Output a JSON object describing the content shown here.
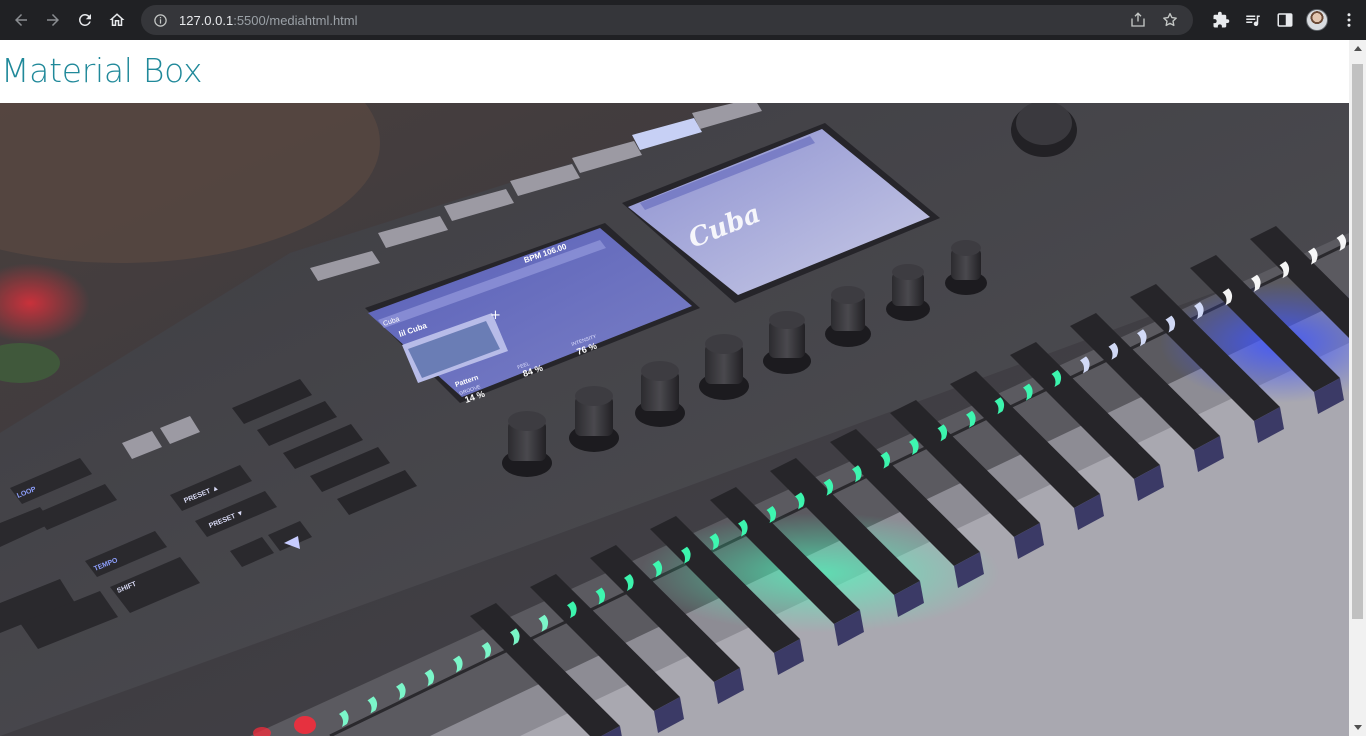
{
  "browser": {
    "url_host": "127.0.0.1",
    "url_rest": ":5500/mediahtml.html",
    "icons": [
      "back-icon",
      "forward-icon",
      "reload-icon",
      "home-icon",
      "site-info-icon",
      "share-icon",
      "bookmark-star-icon",
      "extensions-icon",
      "media-queue-icon",
      "side-panel-icon",
      "profile-avatar",
      "menu-dots-icon"
    ]
  },
  "page": {
    "title": "Material Box",
    "title_color": "#20899a",
    "image": {
      "subject": "MIDI keyboard controller with illuminated keys",
      "screen_left": {
        "header": "BPM 106.00",
        "label": "Cuba",
        "preset": "lil Cuba",
        "pattern": "Pattern",
        "groove": "GROOVE",
        "groove_value": "14 %",
        "feel": "FEEL",
        "feel_value": "84 %",
        "intensity": "INTENSITY",
        "intensity_value": "76 %"
      },
      "screen_right": {
        "logo": "Cuba"
      },
      "buttons": {
        "preset_up": "PRESET ▲",
        "preset_down": "PRESET ▼",
        "tempo": "TEMPO",
        "shift": "SHIFT",
        "loop": "LOOP"
      }
    }
  }
}
